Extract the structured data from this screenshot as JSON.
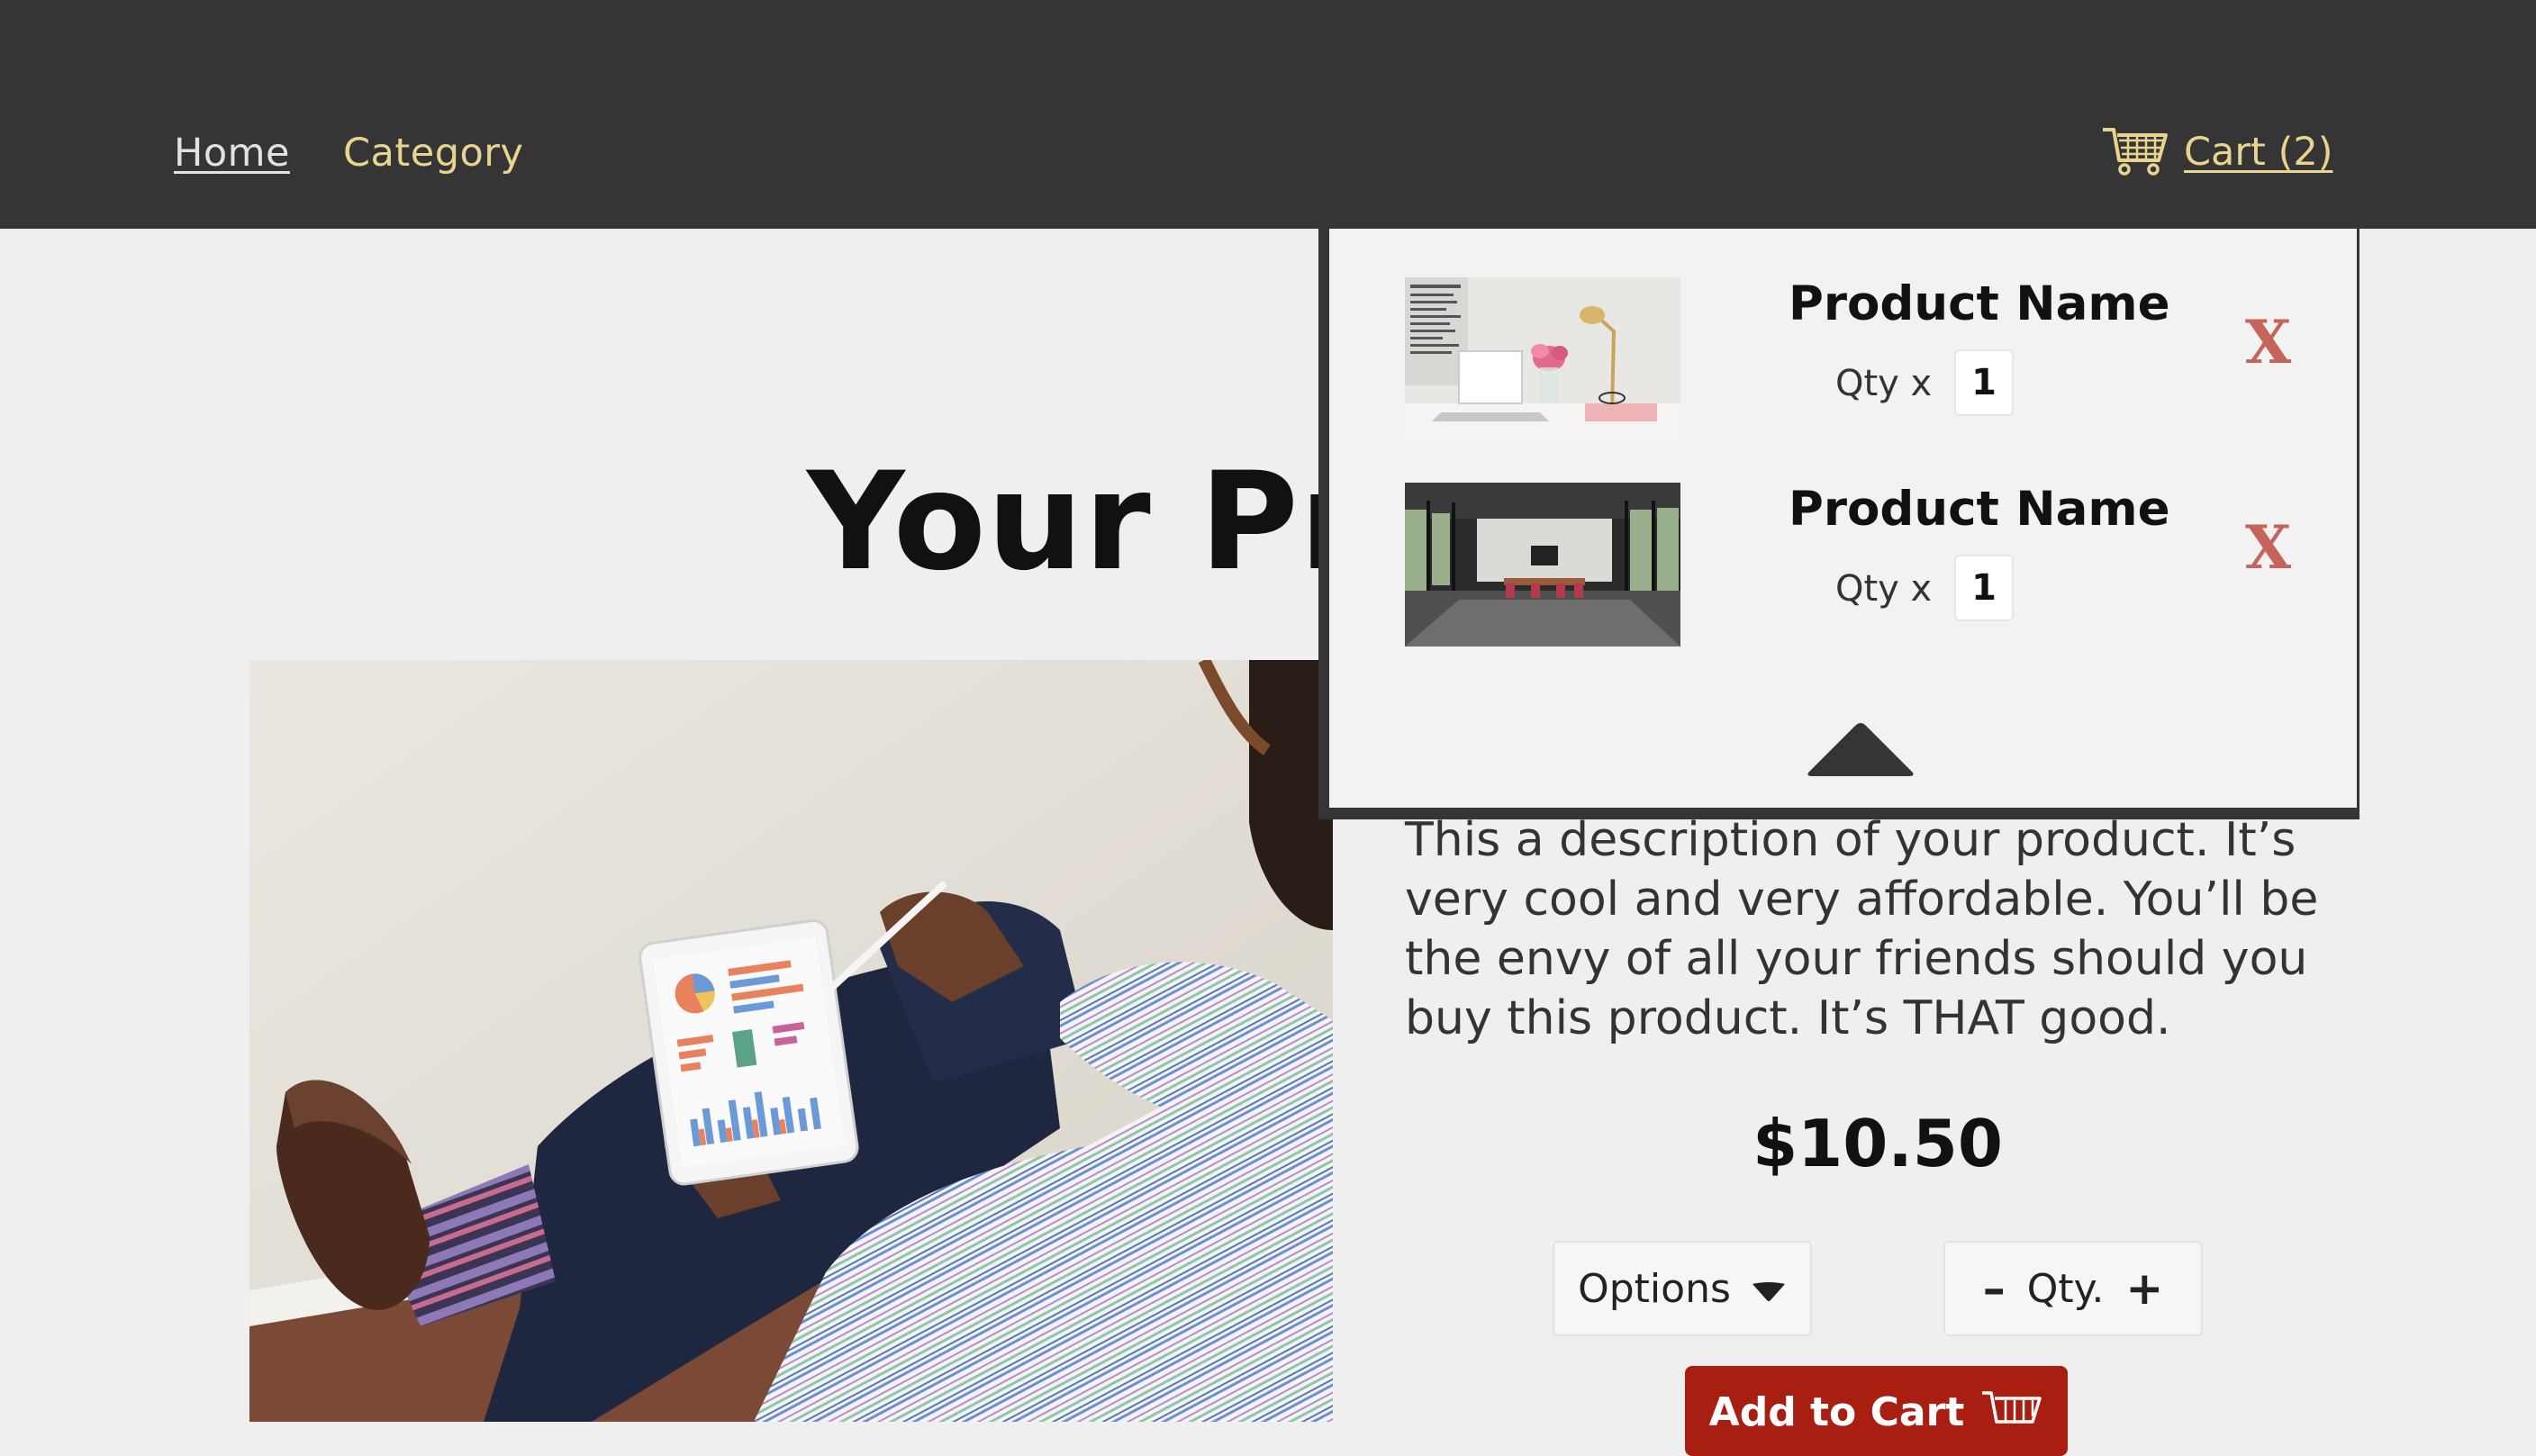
{
  "nav": {
    "home": "Home",
    "category": "Category",
    "cart_label": "Cart (2)"
  },
  "page": {
    "title": "Your Product"
  },
  "product": {
    "description": "This a description of your product. It’s very cool and very affordable. You’ll be the envy of all your friends should you buy this product. It’s THAT good.",
    "price": "$10.50",
    "options_label": "Options",
    "qty_label": "Qty.",
    "minus": "–",
    "plus": "+",
    "add_to_cart": "Add to Cart"
  },
  "cart": {
    "items": [
      {
        "name": "Product Name",
        "qty_label": "Qty x",
        "qty": "1",
        "remove": "X"
      },
      {
        "name": "Product Name",
        "qty_label": "Qty x",
        "qty": "1",
        "remove": "X"
      }
    ]
  },
  "colors": {
    "nav_bg": "#353535",
    "nav_link_accent": "#e8d48e",
    "remove_x": "#c5645a",
    "add_to_cart_bg": "#a81e10",
    "page_bg": "#efefef"
  },
  "icons": {
    "cart": "shopping-cart-icon",
    "dropdown": "caret-down-icon",
    "collapse": "caret-up-icon"
  }
}
